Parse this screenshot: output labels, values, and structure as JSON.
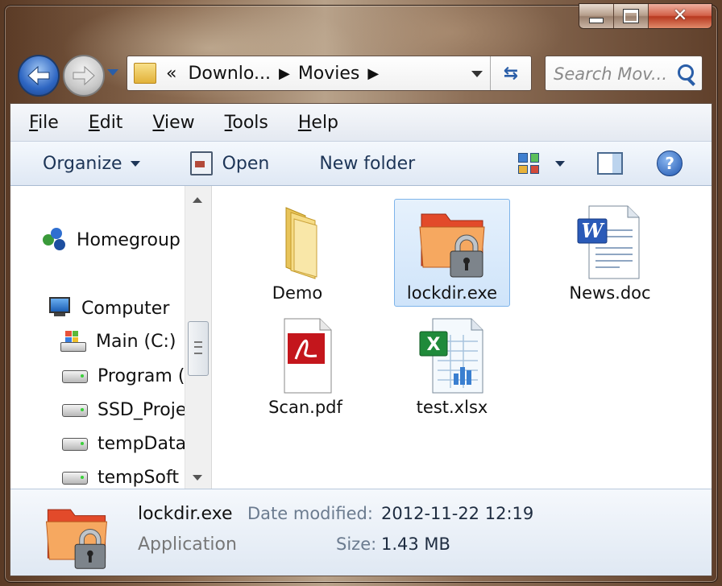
{
  "window": {
    "caption": {
      "minimize": "minimize",
      "maximize": "maximize",
      "close": "close"
    }
  },
  "address_bar": {
    "overflow": "«",
    "crumbs": [
      "Downlo...",
      "Movies"
    ]
  },
  "search": {
    "placeholder": "Search Mov..."
  },
  "menu": [
    "File",
    "Edit",
    "View",
    "Tools",
    "Help"
  ],
  "toolbar": {
    "organize": "Organize",
    "open": "Open",
    "new_folder": "New folder"
  },
  "nav_pane": {
    "homegroup": "Homegroup",
    "computer": "Computer",
    "drives": [
      "Main (C:)",
      "Program (",
      "SSD_Proje",
      "tempData",
      "tempSoft ("
    ]
  },
  "files": [
    {
      "name": "Demo",
      "icon": "folder-icon"
    },
    {
      "name": "lockdir.exe",
      "icon": "locked-folder-icon",
      "selected": true
    },
    {
      "name": "News.doc",
      "icon": "word-document-icon"
    },
    {
      "name": "Scan.pdf",
      "icon": "pdf-icon"
    },
    {
      "name": "test.xlsx",
      "icon": "excel-spreadsheet-icon"
    }
  ],
  "details": {
    "name": "lockdir.exe",
    "type": "Application",
    "date_modified_label": "Date modified:",
    "date_modified": "2012-11-22 12:19",
    "size_label": "Size:",
    "size": "1.43 MB"
  },
  "colors": {
    "selection_bg": "#cfe4fa",
    "selection_border": "#7eb4ea",
    "toolbar_text": "#1d3557"
  }
}
